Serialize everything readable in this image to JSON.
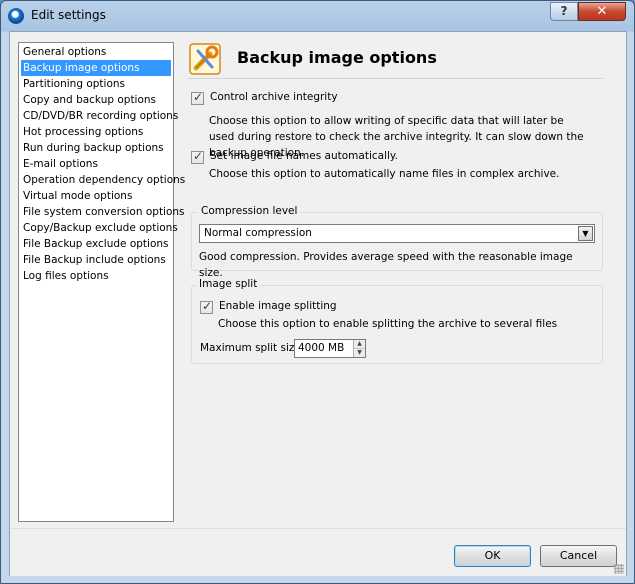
{
  "window": {
    "title": "Edit settings",
    "help_label": "?",
    "close_label": "✕"
  },
  "nav": {
    "items": [
      "General options",
      "Backup image options",
      "Partitioning options",
      "Copy and backup options",
      "CD/DVD/BR recording options",
      "Hot processing options",
      "Run during backup options",
      "E-mail options",
      "Operation dependency options",
      "Virtual mode options",
      "File system conversion options",
      "Copy/Backup exclude options",
      "File Backup exclude options",
      "File Backup include options",
      "Log files options"
    ],
    "selected": "Backup image options"
  },
  "page": {
    "title": "Backup image options",
    "icon": "tools-settings-icon",
    "control_integrity": {
      "label": "Control archive integrity",
      "checked": true,
      "description": "Choose this option to allow writing of specific data that will later be used during restore to check the archive integrity. It can slow down the backup operation."
    },
    "auto_names": {
      "label": "Set image file names automatically.",
      "checked": true,
      "description": "Choose this option to automatically name files in complex archive."
    },
    "compression": {
      "group_title": "Compression level",
      "selected": "Normal compression",
      "description": "Good compression. Provides average speed with the reasonable image size."
    },
    "split": {
      "group_title": "Image split",
      "enable_label": "Enable image splitting",
      "checked": true,
      "description": "Choose this option to enable splitting the archive to several files",
      "max_size_label": "Maximum split size:",
      "max_size_value": "4000 MB"
    }
  },
  "buttons": {
    "ok": "OK",
    "cancel": "Cancel"
  },
  "colors": {
    "selection": "#3399ff",
    "close": "#c5482d"
  }
}
